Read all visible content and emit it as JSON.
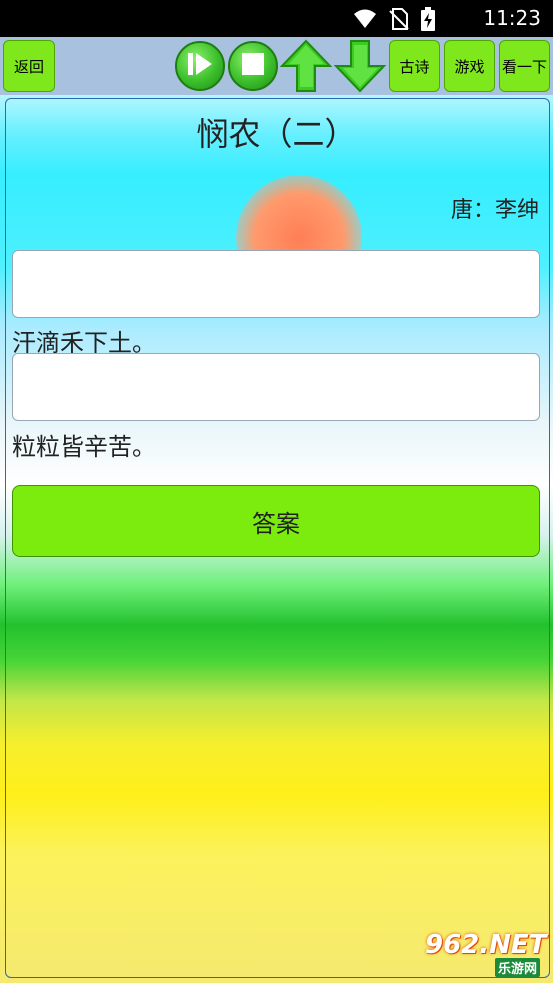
{
  "status_bar": {
    "time": "11:23",
    "icons": [
      "wifi-icon",
      "no-sim-icon",
      "battery-charging-icon"
    ]
  },
  "toolbar": {
    "back_label": "返回",
    "play_icon": "play-icon",
    "stop_icon": "stop-icon",
    "prev_icon": "up-arrow-icon",
    "next_icon": "down-arrow-icon",
    "poems_label": "古诗",
    "game_label": "游戏",
    "look_label": "看一下"
  },
  "poem": {
    "title": "悯农（二）",
    "author": "唐：李绅",
    "blank_1_value": "",
    "line_1": "汗滴禾下土。",
    "blank_2_value": "",
    "line_2": "粒粒皆辛苦。"
  },
  "answer_label": "答案",
  "watermark": {
    "main": "962.NET",
    "sub": "乐游网"
  },
  "colors": {
    "button_green": "#7fe81c",
    "toolbar_bg": "#a8c1de",
    "frame_border": "#2a6ab3"
  }
}
